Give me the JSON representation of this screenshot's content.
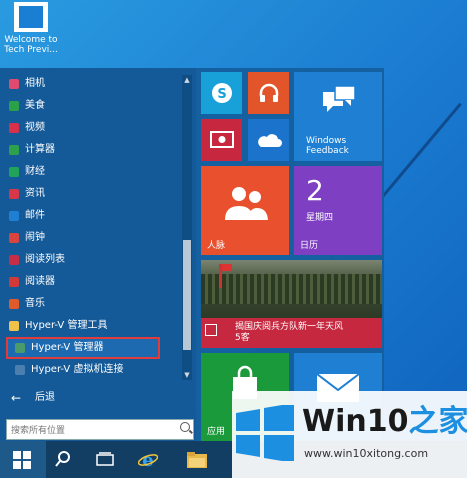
{
  "desktop": {
    "icon_label_line1": "Welcome to",
    "icon_label_line2": "Tech Previ..."
  },
  "start_menu": {
    "apps": [
      {
        "label": "相机",
        "color": "#e04a6c"
      },
      {
        "label": "美食",
        "color": "#2aa048"
      },
      {
        "label": "视频",
        "color": "#d9304c"
      },
      {
        "label": "计算器",
        "color": "#2da04d"
      },
      {
        "label": "财经",
        "color": "#21a35a"
      },
      {
        "label": "资讯",
        "color": "#d8374a"
      },
      {
        "label": "邮件",
        "color": "#1e7fd3"
      },
      {
        "label": "闹钟",
        "color": "#d9443e"
      },
      {
        "label": "阅读列表",
        "color": "#c82d48"
      },
      {
        "label": "阅读器",
        "color": "#d23a3a"
      },
      {
        "label": "音乐",
        "color": "#e05a2a"
      },
      {
        "label": "Hyper-V 管理工具",
        "color": "#f0c24a"
      },
      {
        "label": "Hyper-V 管理器",
        "color": "#4a9a6a"
      },
      {
        "label": "Hyper-V 虚拟机连接",
        "color": "#4a7fb0"
      }
    ],
    "back_label": "后退",
    "search_placeholder": "搜索所有位置"
  },
  "tiles": {
    "skype": {
      "color": "#18a0d8",
      "icon": "skype-icon"
    },
    "music": {
      "color": "#e2542a",
      "icon": "headphones-icon"
    },
    "video": {
      "color": "#c8283f",
      "icon": "video-icon"
    },
    "onedrive": {
      "color": "#1b73cc",
      "icon": "cloud-icon"
    },
    "feedback": {
      "color": "#1e7fd3",
      "label_line1": "Windows",
      "label_line2": "Feedback",
      "icon": "feedback-icon"
    },
    "people": {
      "color": "#e8502e",
      "label": "人脉",
      "icon": "people-icon"
    },
    "calendar": {
      "color": "#7e3fc2",
      "day": "2",
      "weekday": "星期四",
      "label": "日历"
    },
    "news": {
      "color": "#c6283f",
      "headline_line1": "揭国庆阅兵方队新一年天风",
      "headline_line2": "5客"
    },
    "store": {
      "color": "#1a9a3a",
      "label": "应用"
    },
    "mail": {
      "color": "#1e7fd3",
      "icon": "mail-icon"
    }
  },
  "taskbar": {
    "items": [
      {
        "name": "start-button",
        "icon": "windows-logo-icon"
      },
      {
        "name": "search-button",
        "icon": "search-icon"
      },
      {
        "name": "task-view-button",
        "icon": "task-view-icon"
      },
      {
        "name": "ie-button",
        "icon": "internet-explorer-icon"
      },
      {
        "name": "explorer-button",
        "icon": "folder-icon"
      }
    ]
  },
  "watermark": {
    "title": "Win10",
    "title_suffix": "之家",
    "url": "www.win10xitong.com"
  }
}
